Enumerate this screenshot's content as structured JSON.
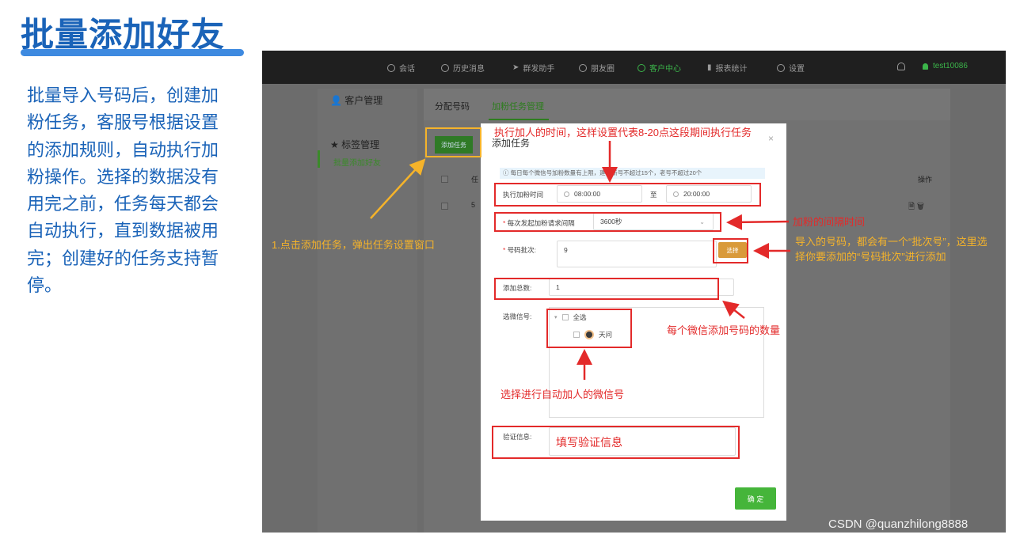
{
  "slide": {
    "title": "批量添加好友",
    "description": "批量导入号码后，创建加粉任务，客服号根据设置的添加规则，自动执行加粉操作。选择的数据没有用完之前，任务每天都会自动执行，直到数据被用完；创建好的任务支持暂停。"
  },
  "topnav": {
    "items": [
      {
        "label": "会话",
        "icon": "chat-icon"
      },
      {
        "label": "历史消息",
        "icon": "clock-icon"
      },
      {
        "label": "群发助手",
        "icon": "send-icon"
      },
      {
        "label": "朋友圈",
        "icon": "moments-icon"
      },
      {
        "label": "客户中心",
        "icon": "user-icon",
        "active": true
      },
      {
        "label": "报表统计",
        "icon": "chart-icon"
      },
      {
        "label": "设置",
        "icon": "gear-icon"
      }
    ],
    "username": "test10086"
  },
  "sidebar": {
    "customer_mgmt": "客户管理",
    "batch_add": "批量添加好友",
    "tag_mgmt": "标签管理"
  },
  "tabs": {
    "tab1": "分配号码",
    "tab2": "加粉任务管理"
  },
  "page": {
    "add_task_button": "添加任务",
    "col_task": "任",
    "col_ops": "操作",
    "row_num": "5"
  },
  "modal": {
    "title": "添加任务",
    "close": "×",
    "notice": "ⓘ 每日每个微信号加粉数量有上限，建议新号不超过15个，老号不超过20个",
    "exec_time_label": "执行加粉时间",
    "start_time": "08:00:00",
    "to_label": "至",
    "end_time": "20:00:00",
    "interval_label": "每次发起加粉请求间隔",
    "interval_value": "3600秒",
    "batch_label": "号码批次:",
    "batch_value": "9",
    "pick_button": "选择",
    "total_label": "添加总数:",
    "total_value": "1",
    "wechat_label": "选微信号:",
    "select_all": "全选",
    "wechat_account": "天问",
    "verify_label": "验证信息:",
    "verify_value": "填写验证信息",
    "confirm_button": "确 定"
  },
  "annotations": {
    "exec_time": "执行加人的时间，这样设置代表8-20点这段期间执行任务",
    "interval": "加粉的间隔时间",
    "batch": "导入的号码，都会有一个“批次号”，这里选择你要添加的“号码批次”进行添加",
    "total": "每个微信添加号码的数量",
    "wechat": "选择进行自动加人的微信号",
    "step1": "1.点击添加任务，弹出任务设置窗口"
  },
  "watermark": "CSDN @quanzhilong8888",
  "colors": {
    "red": "#e32a2a",
    "yellow": "#f5b32a",
    "green": "#3bb54a",
    "blue": "#1a63b8"
  }
}
